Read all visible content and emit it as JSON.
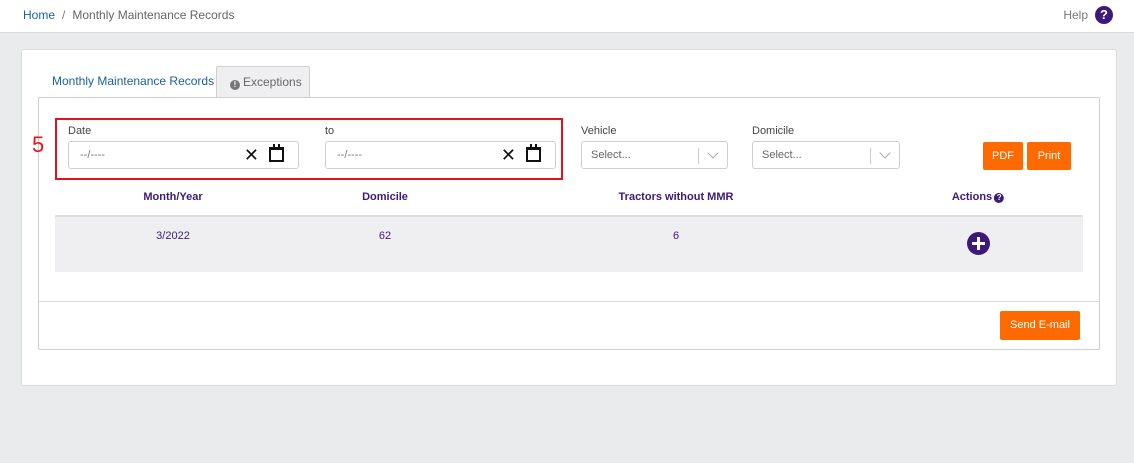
{
  "breadcrumb": {
    "home": "Home",
    "separator": "/",
    "current": "Monthly Maintenance Records"
  },
  "help": {
    "label": "Help",
    "icon": "question-circle-icon",
    "glyph": "?"
  },
  "tabs": [
    {
      "label": "Monthly Maintenance Records",
      "active": false
    },
    {
      "label": "Exceptions",
      "active": true,
      "icon": "info-circle-icon",
      "glyph": "!"
    }
  ],
  "annotation": {
    "number": "5"
  },
  "filters": {
    "date_label": "Date",
    "date_placeholder": "--/----",
    "to_label": "to",
    "to_placeholder": "--/----",
    "clear_glyph": "✕",
    "vehicle_label": "Vehicle",
    "vehicle_placeholder": "Select...",
    "domicile_label": "Domicile",
    "domicile_placeholder": "Select..."
  },
  "buttons": {
    "pdf": "PDF",
    "print": "Print",
    "send_email": "Send E-mail"
  },
  "table": {
    "columns": [
      "Month/Year",
      "Domicile",
      "Tractors without MMR",
      "Actions"
    ],
    "actions_help_glyph": "?",
    "rows": [
      {
        "month_year": "3/2022",
        "domicile": "62",
        "tractors_without_mmr": "6"
      }
    ]
  },
  "colors": {
    "accent": "#ff6a00",
    "brand": "#3d1a78",
    "link": "#1a5f9e",
    "annotation": "#e0141c"
  }
}
